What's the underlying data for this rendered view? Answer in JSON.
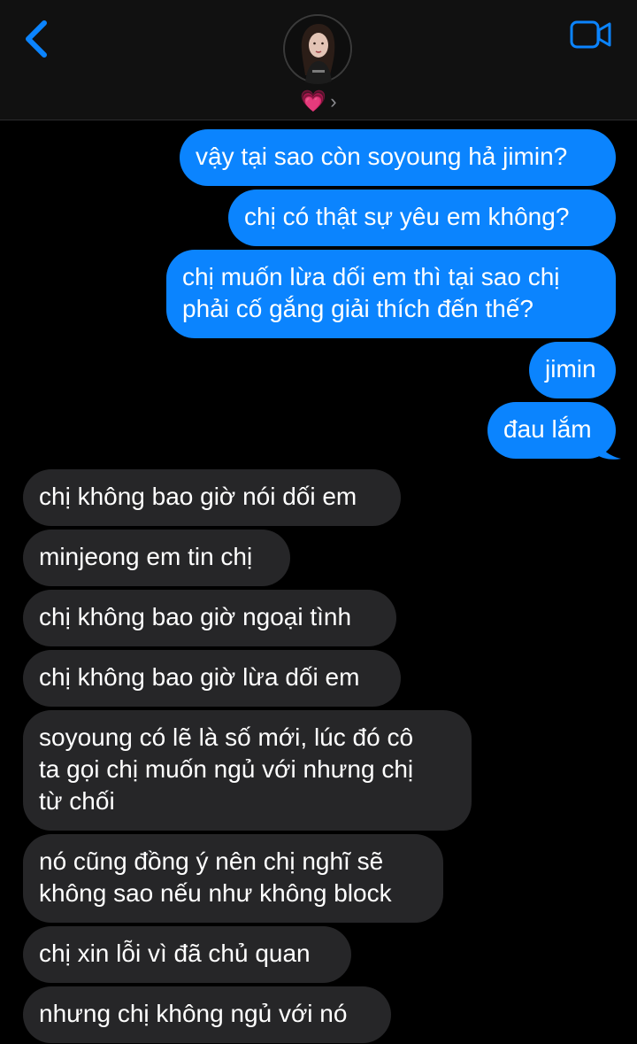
{
  "header": {
    "back_icon": "chevron-left-icon",
    "video_icon": "video-camera-icon",
    "contact_name": "💗",
    "contact_chevron": "›",
    "avatar_icon": "contact-avatar"
  },
  "colors": {
    "background": "#000000",
    "header_bg": "#111111",
    "accent": "#0b84fe",
    "outgoing_bubble": "#0b84fe",
    "incoming_bubble": "#262628"
  },
  "messages": [
    {
      "dir": "out",
      "lines": [
        "vậy tại sao còn soyoung hả jimin?"
      ]
    },
    {
      "dir": "out",
      "lines": [
        "chị có thật sự yêu em không?"
      ]
    },
    {
      "dir": "out",
      "lines": [
        "chị muốn lừa dối em thì tại sao chị",
        "phải cố gắng giải thích đến thế?"
      ]
    },
    {
      "dir": "out",
      "lines": [
        "jimin"
      ]
    },
    {
      "dir": "out",
      "lines": [
        "đau lắm"
      ]
    },
    {
      "dir": "in",
      "lines": [
        "chị không bao giờ nói dối em"
      ]
    },
    {
      "dir": "in",
      "lines": [
        "minjeong em tin chị"
      ]
    },
    {
      "dir": "in",
      "lines": [
        "chị không bao giờ ngoại tình"
      ]
    },
    {
      "dir": "in",
      "lines": [
        "chị không bao giờ lừa dối em"
      ]
    },
    {
      "dir": "in",
      "lines": [
        "soyoung có lẽ là số mới, lúc đó cô",
        "ta gọi chị muốn ngủ với nhưng chị",
        "từ chối"
      ]
    },
    {
      "dir": "in",
      "lines": [
        "nó cũng đồng ý nên chị nghĩ sẽ",
        "không sao nếu như không block"
      ]
    },
    {
      "dir": "in",
      "lines": [
        "chị xin lỗi vì đã chủ quan"
      ]
    },
    {
      "dir": "in",
      "lines": [
        "nhưng chị không ngủ với nó"
      ]
    }
  ]
}
